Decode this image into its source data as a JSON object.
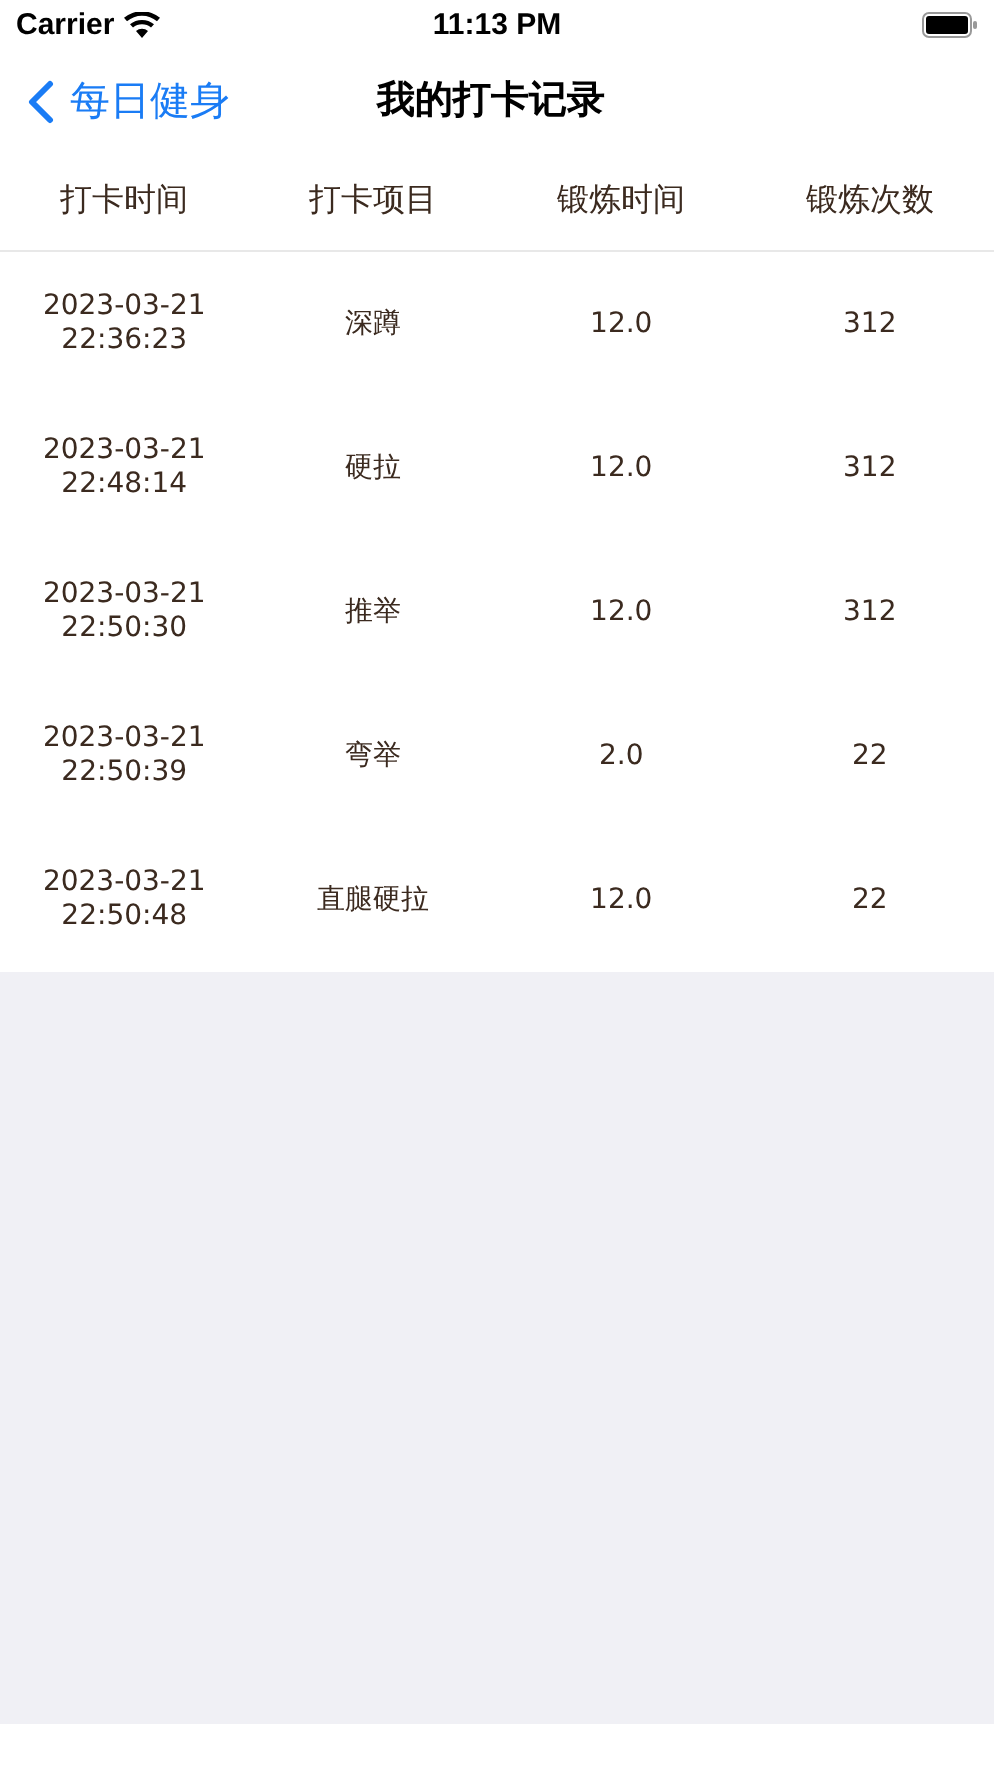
{
  "status_bar": {
    "carrier": "Carrier",
    "time": "11:13 PM"
  },
  "nav": {
    "back_label": "每日健身",
    "title": "我的打卡记录"
  },
  "table": {
    "columns": [
      "打卡时间",
      "打卡项目",
      "锻炼时间",
      "锻炼次数"
    ],
    "rows": [
      {
        "time": "2023-03-21\n22:36:23",
        "item": "深蹲",
        "duration": "12.0",
        "count": "312"
      },
      {
        "time": "2023-03-21\n22:48:14",
        "item": "硬拉",
        "duration": "12.0",
        "count": "312"
      },
      {
        "time": "2023-03-21\n22:50:30",
        "item": "推举",
        "duration": "12.0",
        "count": "312"
      },
      {
        "time": "2023-03-21\n22:50:39",
        "item": "弯举",
        "duration": "2.0",
        "count": "22"
      },
      {
        "time": "2023-03-21\n22:50:48",
        "item": "直腿硬拉",
        "duration": "12.0",
        "count": "22"
      }
    ]
  }
}
